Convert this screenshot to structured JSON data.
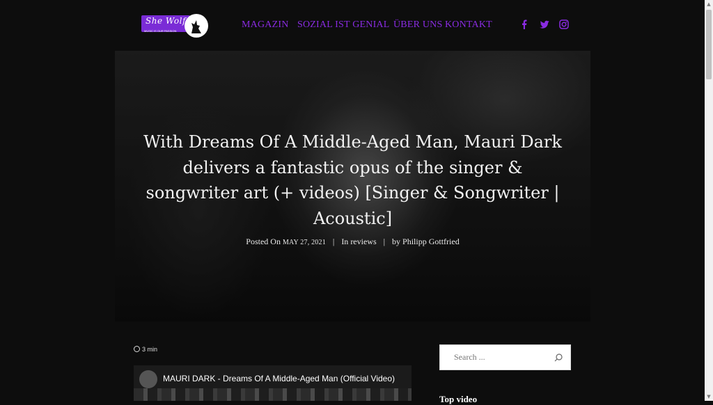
{
  "header": {
    "logo": {
      "text": "She Wolf",
      "tagline": "MUSIC IS OUR PASSION"
    },
    "nav": [
      {
        "label": "MAGAZIN"
      },
      {
        "label": "SOZIAL IST GENIAL"
      },
      {
        "label": "ÜBER UNS"
      },
      {
        "label": "KONTAKT"
      }
    ],
    "social": [
      "facebook-icon",
      "twitter-icon",
      "instagram-icon"
    ],
    "accent_color": "#8a2be2"
  },
  "article": {
    "title": "With Dreams Of A Middle-Aged Man, Mauri Dark delivers a fantastic opus of the singer & songwriter art (+ videos) [Singer & Songwriter | Acoustic]",
    "meta": {
      "posted_prefix": "Posted On",
      "date": "MAY 27, 2021",
      "category_prefix": "In",
      "category": "reviews",
      "author_prefix": "by",
      "author": "Philipp Gottfried"
    },
    "read_time": "3 min",
    "video": {
      "title": "MAURI DARK - Dreams Of A Middle-Aged Man (Official Video)"
    }
  },
  "sidebar": {
    "search": {
      "placeholder": "Search ..."
    },
    "heading": "Top video"
  }
}
